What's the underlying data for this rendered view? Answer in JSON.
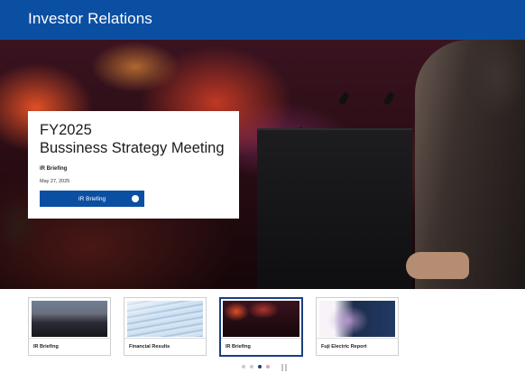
{
  "header": {
    "title": "Investor Relations"
  },
  "hero": {
    "title_line1": "FY2025",
    "title_line2": "Bussiness Strategy Meeting",
    "category": "IR Briefing",
    "date": "May 27, 2025",
    "button_label": "IR Briefing",
    "button_icon": "circle-icon"
  },
  "thumbnails": [
    {
      "label": "IR Briefing",
      "active": false
    },
    {
      "label": "Financial Results",
      "active": false
    },
    {
      "label": "IR Briefing",
      "active": true
    },
    {
      "label": "Fuji Electric Report",
      "active": false
    }
  ],
  "pager": {
    "total": 4,
    "active_index": 2,
    "pause_icon": "pause-icon"
  },
  "colors": {
    "brand_blue": "#0b4fa3",
    "active_border": "#1a3f80"
  }
}
